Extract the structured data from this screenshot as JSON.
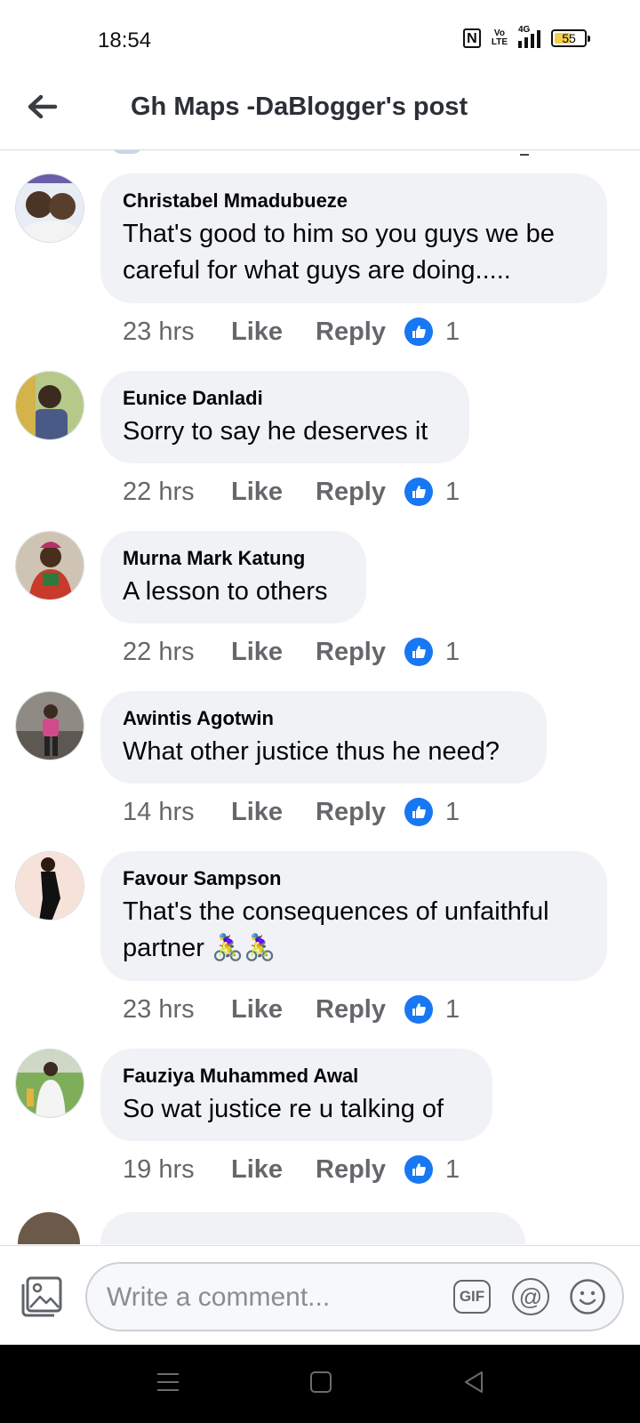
{
  "status_bar": {
    "time": "18:54",
    "nfc_label": "N",
    "volte_top": "Vo",
    "volte_bottom": "LTE",
    "network": "4G",
    "battery": "55",
    "battery_level": 0.55
  },
  "header": {
    "title": "Gh Maps -DaBlogger's post",
    "back_icon": "back-arrow-icon"
  },
  "actions": {
    "like_label": "Like",
    "reply_label": "Reply"
  },
  "comments": [
    {
      "author": "Christabel Mmadubueze",
      "text": "That's good to him so you guys we be\ncareful for what guys are doing.....",
      "time": "23 hrs",
      "likes": "1"
    },
    {
      "author": "Eunice Danladi",
      "text": "Sorry to say he deserves it",
      "time": "22 hrs",
      "likes": "1"
    },
    {
      "author": "Murna Mark Katung",
      "text": "A lesson to others",
      "time": "22 hrs",
      "likes": "1"
    },
    {
      "author": "Awintis Agotwin",
      "text": "What other justice thus he need?",
      "time": "14 hrs",
      "likes": "1"
    },
    {
      "author": "Favour Sampson",
      "text": "That's the consequences of unfaithful\npartner 🚴‍♀️🚴‍♀️",
      "time": "23 hrs",
      "likes": "1"
    },
    {
      "author": "Fauziya Muhammed Awal",
      "text": "So wat justice re u talking of",
      "time": "19 hrs",
      "likes": "1"
    }
  ],
  "composer": {
    "placeholder": "Write a comment...",
    "gif_label": "GIF",
    "at_label": "@"
  },
  "colors": {
    "accent": "#1877f2",
    "bubble": "#f0f2f5",
    "secondary_text": "#65676b"
  }
}
